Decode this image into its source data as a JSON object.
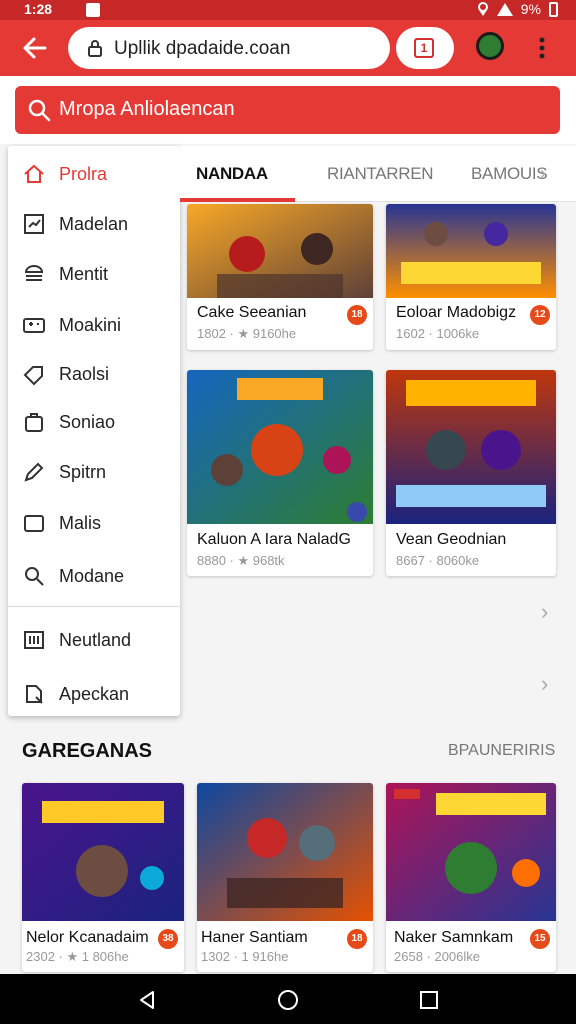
{
  "status_bar": {
    "time": "1:28",
    "battery": "9%"
  },
  "browser": {
    "url": "Upllik dpadaide.coan",
    "tab_count": "1"
  },
  "search": {
    "placeholder": "Mropa Anliolaencan"
  },
  "sidebar": {
    "items": [
      {
        "label": "Prolra",
        "icon": "home-icon"
      },
      {
        "label": "Madelan",
        "icon": "chart-icon"
      },
      {
        "label": "Mentit",
        "icon": "burger-icon"
      },
      {
        "label": "Moakini",
        "icon": "controller-icon"
      },
      {
        "label": "Raolsi",
        "icon": "tag-icon"
      },
      {
        "label": "Soniao",
        "icon": "bag-icon"
      },
      {
        "label": "Spitrn",
        "icon": "pen-icon"
      },
      {
        "label": "Malis",
        "icon": "folder-icon"
      },
      {
        "label": "Modane",
        "icon": "search-user-icon"
      },
      {
        "label": "Neutland",
        "icon": "grid-icon"
      },
      {
        "label": "Apeckan",
        "icon": "search-icon"
      }
    ]
  },
  "tabs": [
    {
      "label": "NANDAA"
    },
    {
      "label": "RIANTARREN"
    },
    {
      "label": "BAMOUIS"
    }
  ],
  "main_cards": [
    {
      "title": "Cake Seeanian",
      "meta": "1802 · ★ 9160he",
      "badge": "18"
    },
    {
      "title": "Eoloar Madobigz",
      "meta": "1602 · 1006ke",
      "badge": "12"
    },
    {
      "title": "Kaluon A Iara NaladG",
      "meta": "8880 · ★ 968tk",
      "badge": ""
    },
    {
      "title": "Vean Geodnian",
      "meta": "8667 · 8060ke",
      "badge": ""
    }
  ],
  "section": {
    "title": "GAREGANAS",
    "link": "BPAUNERIRIS"
  },
  "bottom_cards": [
    {
      "title": "Nelor Kcanadaim",
      "meta": "2302 · ★ 1 806he",
      "badge": "38"
    },
    {
      "title": "Haner Santiam",
      "meta": "1302 · 1 916he",
      "badge": "18"
    },
    {
      "title": "Naker Samnkam",
      "meta": "2658 · 2006lke",
      "badge": "15"
    }
  ],
  "colors": {
    "accent": "#e53935",
    "dark_accent": "#c62828",
    "badge": "#e64a19"
  }
}
